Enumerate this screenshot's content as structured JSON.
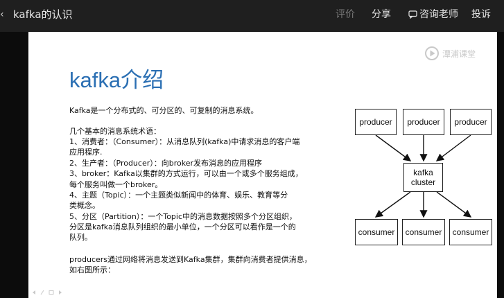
{
  "header": {
    "back_glyph": "‹",
    "title": "kafka的认识",
    "nav": {
      "evaluate": "评价",
      "share": "分享",
      "consult": "咨询老师",
      "complain": "投诉"
    }
  },
  "slide": {
    "logo_text": "潭浦课堂",
    "heading": "kafka介绍",
    "intro": "Kafka是一个分布式的、可分区的、可复制的消息系统。",
    "terms_title": "几个基本的消息系统术语：",
    "terms": [
      "1、消费者：（Consumer）：从消息队列(kafka)中请求消息的客户端",
      "应用程序.",
      "2、生产者：（Producer）：向broker发布消息的应用程序",
      "3、broker：Kafka以集群的方式运行，可以由一个或多个服务组成，",
      "每个服务叫做一个broker。",
      "4、主题（Topic）：一个主题类似新闻中的体育、娱乐、教育等分",
      "类概念。",
      "5、分区（Partition）：一个Topic中的消息数据按照多个分区组织，",
      "分区是kafka消息队列组织的最小单位，一个分区可以看作是一个的",
      "队列。"
    ],
    "summary": [
      "producers通过网络将消息发送到Kafka集群，集群向消费者提供消息，",
      "如右图所示："
    ],
    "diagram": {
      "producers": [
        "producer",
        "producer",
        "producer"
      ],
      "cluster_line1": "kafka",
      "cluster_line2": "cluster",
      "consumers": [
        "consumer",
        "consumer",
        "consumer"
      ]
    }
  },
  "icons": {
    "consult_icon": "chat-bubble-icon",
    "logo_icon": "play-circle-icon"
  }
}
